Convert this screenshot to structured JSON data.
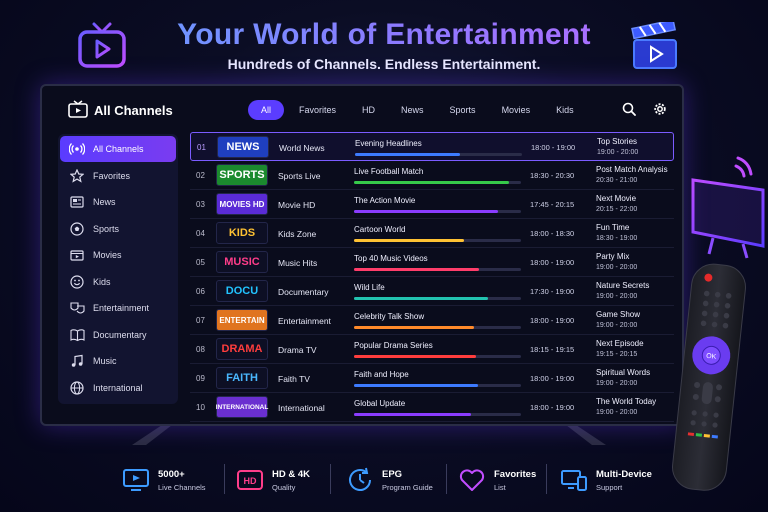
{
  "hero": {
    "title": "Your World of Entertainment",
    "subtitle": "Hundreds of Channels. Endless Entertainment."
  },
  "app": {
    "title": "All Channels",
    "tabs": [
      {
        "label": "All",
        "active": true
      },
      {
        "label": "Favorites"
      },
      {
        "label": "HD"
      },
      {
        "label": "News"
      },
      {
        "label": "Sports"
      },
      {
        "label": "Movies"
      },
      {
        "label": "Kids"
      }
    ]
  },
  "sidebar": {
    "items": [
      {
        "label": "All Channels",
        "icon": "broadcast-icon",
        "active": true
      },
      {
        "label": "Favorites",
        "icon": "star-icon"
      },
      {
        "label": "News",
        "icon": "newspaper-icon"
      },
      {
        "label": "Sports",
        "icon": "soccer-ball-icon"
      },
      {
        "label": "Movies",
        "icon": "film-icon"
      },
      {
        "label": "Kids",
        "icon": "smiley-icon"
      },
      {
        "label": "Entertainment",
        "icon": "theater-masks-icon"
      },
      {
        "label": "Documentary",
        "icon": "book-icon"
      },
      {
        "label": "Music",
        "icon": "music-note-icon"
      },
      {
        "label": "International",
        "icon": "globe-icon"
      }
    ]
  },
  "channels": [
    {
      "num": "01",
      "logo": "NEWS",
      "logo_color": "#ffffff",
      "logo_bg": "#1f3fbf",
      "name": "World News",
      "program": "Evening Headlines",
      "progress": 0.63,
      "bar_color": "#3d7bff",
      "time": "18:00 - 19:00",
      "next": "Top Stories",
      "next_time": "19:00 - 20:00",
      "active": true
    },
    {
      "num": "02",
      "logo": "SPORTS",
      "logo_color": "#ffffff",
      "logo_bg": "#1b8a2e",
      "name": "Sports Live",
      "program": "Live Football Match",
      "progress": 0.93,
      "bar_color": "#36c94a",
      "time": "18:30 - 20:30",
      "next": "Post Match Analysis",
      "next_time": "20:30 - 21:00"
    },
    {
      "num": "03",
      "logo": "MOVIES HD",
      "logo_color": "#ffffff",
      "logo_bg": "#5a2bd6",
      "name": "Movie HD",
      "program": "The Action Movie",
      "progress": 0.86,
      "bar_color": "#8a3cff",
      "time": "17:45 - 20:15",
      "next": "Next Movie",
      "next_time": "20:15 - 22:00"
    },
    {
      "num": "04",
      "logo": "KIDS",
      "logo_color": "#ffc233",
      "logo_bg": "#0d0f24",
      "name": "Kids Zone",
      "program": "Cartoon World",
      "progress": 0.66,
      "bar_color": "#ffc233",
      "time": "18:00 - 18:30",
      "next": "Fun Time",
      "next_time": "18:30 - 19:00"
    },
    {
      "num": "05",
      "logo": "MUSIC",
      "logo_color": "#ff3d8a",
      "logo_bg": "#0d0f24",
      "name": "Music Hits",
      "program": "Top 40 Music Videos",
      "progress": 0.75,
      "bar_color": "#ff3d6a",
      "time": "18:00 - 19:00",
      "next": "Party Mix",
      "next_time": "19:00 - 20:00"
    },
    {
      "num": "06",
      "logo": "DOCU",
      "logo_color": "#22c3ff",
      "logo_bg": "#0d0f24",
      "name": "Documentary",
      "program": "Wild Life",
      "progress": 0.8,
      "bar_color": "#22c3b0",
      "time": "17:30 - 19:00",
      "next": "Nature Secrets",
      "next_time": "19:00 - 20:00"
    },
    {
      "num": "07",
      "logo": "ENTERTAIN",
      "logo_color": "#ffffff",
      "logo_bg": "#e0741f",
      "name": "Entertainment",
      "program": "Celebrity Talk Show",
      "progress": 0.72,
      "bar_color": "#ff8a2a",
      "time": "18:00 - 19:00",
      "next": "Game Show",
      "next_time": "19:00 - 20:00"
    },
    {
      "num": "08",
      "logo": "DRAMA",
      "logo_color": "#ff3d3d",
      "logo_bg": "#0d0f24",
      "name": "Drama TV",
      "program": "Popular Drama Series",
      "progress": 0.73,
      "bar_color": "#ff3d3d",
      "time": "18:15 - 19:15",
      "next": "Next Episode",
      "next_time": "19:15 - 20:15"
    },
    {
      "num": "09",
      "logo": "FAITH",
      "logo_color": "#4ab8ff",
      "logo_bg": "#0d0f24",
      "name": "Faith TV",
      "program": "Faith and Hope",
      "progress": 0.74,
      "bar_color": "#3d7bff",
      "time": "18:00 - 19:00",
      "next": "Spiritual Words",
      "next_time": "19:00 - 20:00"
    },
    {
      "num": "10",
      "logo": "INTERNATIONAL",
      "logo_color": "#ffffff",
      "logo_bg": "#6a2fd0",
      "name": "International",
      "program": "Global Update",
      "progress": 0.7,
      "bar_color": "#8a3cff",
      "time": "18:00 - 19:00",
      "next": "The World Today",
      "next_time": "19:00 - 20:00"
    }
  ],
  "features": [
    {
      "title": "5000+",
      "sub": "Live Channels",
      "icon": "tv-play-icon",
      "color": "#3d9bff"
    },
    {
      "title": "HD & 4K",
      "sub": "Quality",
      "icon": "hd-badge-icon",
      "color": "#ff3d8a"
    },
    {
      "title": "EPG",
      "sub": "Program Guide",
      "icon": "clock-refresh-icon",
      "color": "#3d9bff"
    },
    {
      "title": "Favorites",
      "sub": "List",
      "icon": "heart-icon",
      "color": "#c24dff"
    },
    {
      "title": "Multi-Device",
      "sub": "Support",
      "icon": "devices-icon",
      "color": "#3d9bff"
    }
  ],
  "colors": {
    "accent": "#5b3dff",
    "background": "#0b0d24"
  }
}
